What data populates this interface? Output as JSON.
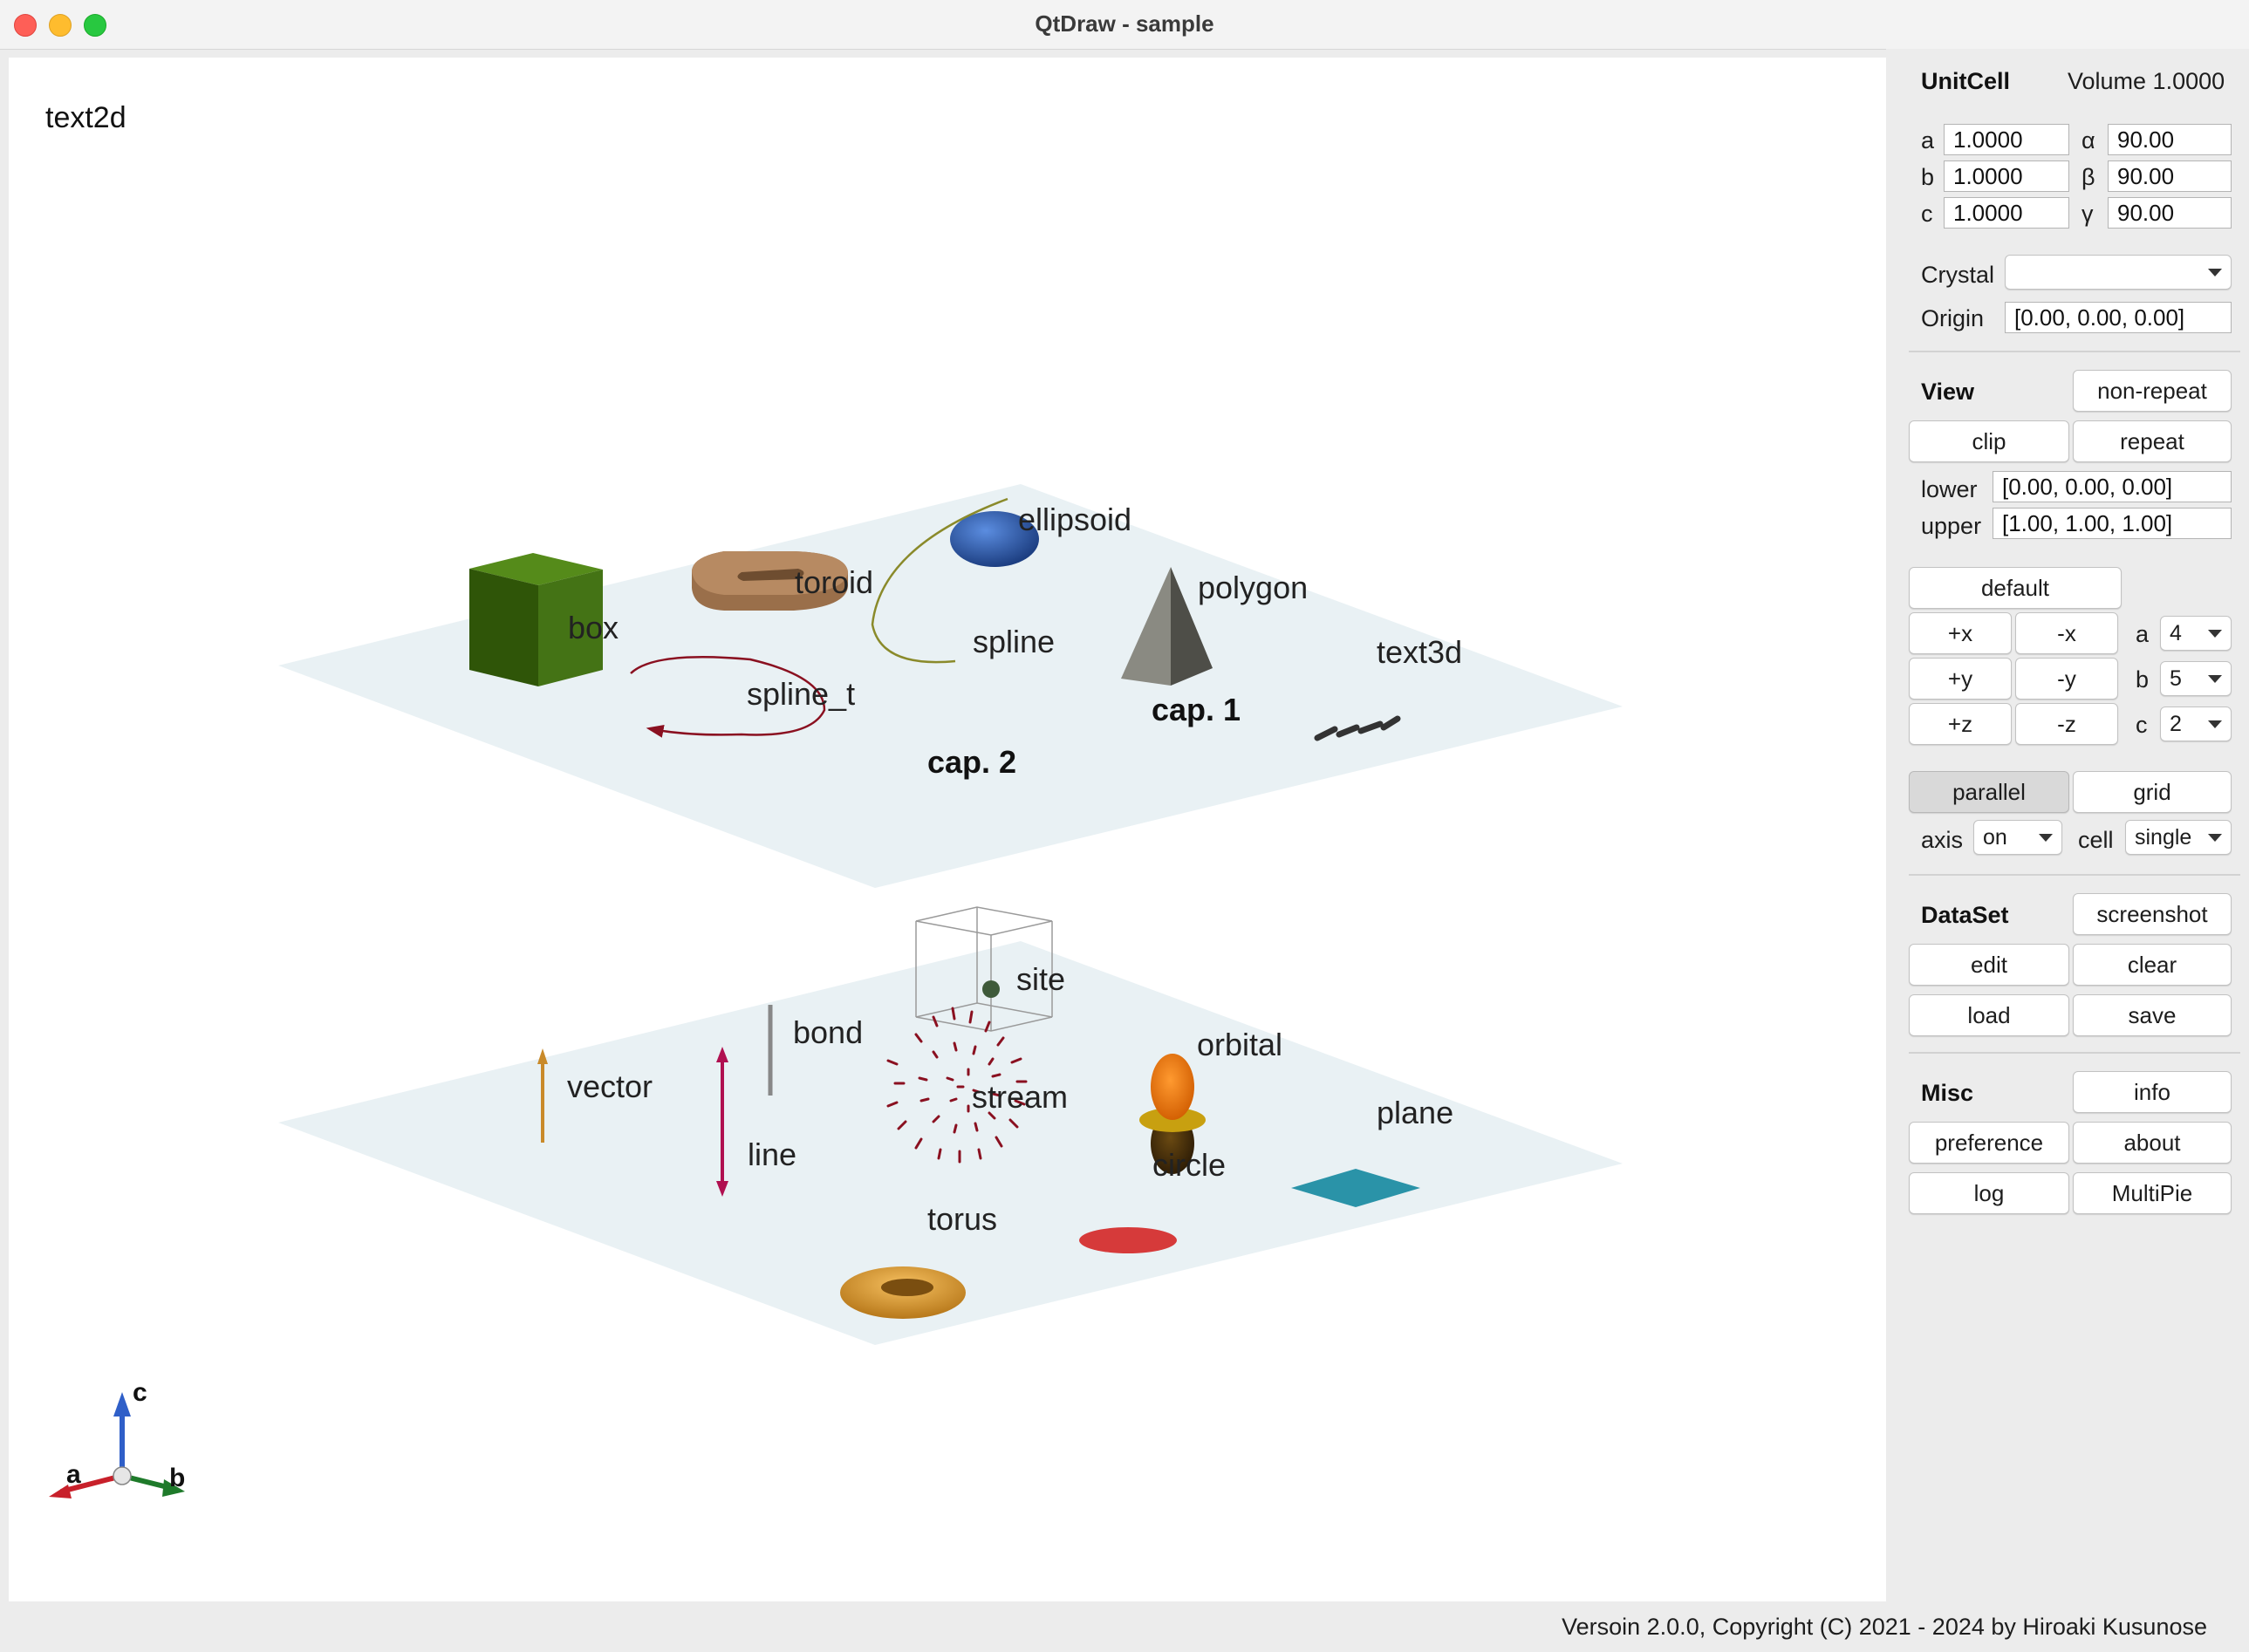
{
  "window": {
    "title": "QtDraw - sample"
  },
  "viewport": {
    "text2d": "text2d",
    "labels": {
      "box": "box",
      "toroid": "toroid",
      "ellipsoid": "ellipsoid",
      "polygon": "polygon",
      "spline": "spline",
      "spline_t": "spline_t",
      "text3d": "text3d",
      "cap1": "cap. 1",
      "cap2": "cap. 2",
      "site": "site",
      "bond": "bond",
      "vector": "vector",
      "line": "line",
      "stream": "stream",
      "orbital": "orbital",
      "plane": "plane",
      "circle": "circle",
      "torus": "torus"
    },
    "axes": {
      "a": "a",
      "b": "b",
      "c": "c"
    }
  },
  "unitcell": {
    "header": "UnitCell",
    "volume": "Volume 1.0000",
    "a_label": "a",
    "b_label": "b",
    "c_label": "c",
    "alpha_label": "α",
    "beta_label": "β",
    "gamma_label": "γ",
    "a": "1.0000",
    "b": "1.0000",
    "c": "1.0000",
    "alpha": "90.00",
    "beta": "90.00",
    "gamma": "90.00",
    "crystal_label": "Crystal",
    "crystal": "",
    "origin_label": "Origin",
    "origin": "[0.00, 0.00, 0.00]"
  },
  "view": {
    "header": "View",
    "non_repeat": "non-repeat",
    "clip": "clip",
    "repeat": "repeat",
    "lower_label": "lower",
    "lower": "[0.00, 0.00, 0.00]",
    "upper_label": "upper",
    "upper": "[1.00, 1.00, 1.00]",
    "default": "default",
    "px": "+x",
    "mx": "-x",
    "py": "+y",
    "my": "-y",
    "pz": "+z",
    "mz": "-z",
    "na_label": "a",
    "nb_label": "b",
    "nc_label": "c",
    "na": "4",
    "nb": "5",
    "nc": "2",
    "parallel": "parallel",
    "grid": "grid",
    "axis_label": "axis",
    "axis": "on",
    "cell_label": "cell",
    "cell": "single"
  },
  "dataset": {
    "header": "DataSet",
    "screenshot": "screenshot",
    "edit": "edit",
    "clear": "clear",
    "load": "load",
    "save": "save"
  },
  "misc": {
    "header": "Misc",
    "info": "info",
    "preference": "preference",
    "about": "about",
    "log": "log",
    "multipie": "MultiPie"
  },
  "status": "Versoin 2.0.0, Copyright (C) 2021 - 2024 by Hiroaki Kusunose",
  "colors": {
    "plane": "#e9f1f4",
    "box": "#3f6b10",
    "toroid": "#a57a55",
    "ellipsoid": "#2b5aa8",
    "spline_t": "#8a1020",
    "line": "#b01050",
    "plane_obj": "#2a93a8",
    "circle": "#d63a3a",
    "torus": "#e0a030",
    "orbital": "#f27a10"
  }
}
